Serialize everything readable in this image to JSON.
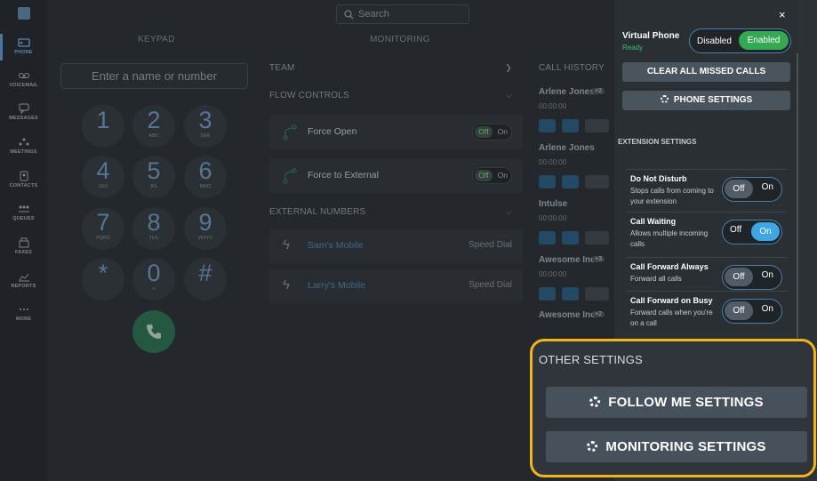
{
  "sidebar": {
    "items": [
      {
        "label": "PHONE",
        "icon": "phone-icon"
      },
      {
        "label": "VOICEMAIL",
        "icon": "voicemail-icon"
      },
      {
        "label": "MESSAGES",
        "icon": "messages-icon"
      },
      {
        "label": "MEETINGS",
        "icon": "meetings-icon"
      },
      {
        "label": "CONTACTS",
        "icon": "contacts-icon"
      },
      {
        "label": "QUEUES",
        "icon": "queues-icon"
      },
      {
        "label": "FAXES",
        "icon": "faxes-icon"
      },
      {
        "label": "REPORTS",
        "icon": "reports-icon"
      },
      {
        "label": "MORE",
        "icon": "more-icon"
      }
    ]
  },
  "search": {
    "placeholder": "Search"
  },
  "tabs": {
    "keypad": "KEYPAD",
    "monitoring": "MONITORING"
  },
  "keypad": {
    "input_placeholder": "Enter a name or number",
    "keys": [
      {
        "digit": "1",
        "letters": ""
      },
      {
        "digit": "2",
        "letters": "ABC"
      },
      {
        "digit": "3",
        "letters": "DEF"
      },
      {
        "digit": "4",
        "letters": "GHI"
      },
      {
        "digit": "5",
        "letters": "JKL"
      },
      {
        "digit": "6",
        "letters": "MNO"
      },
      {
        "digit": "7",
        "letters": "PQRS"
      },
      {
        "digit": "8",
        "letters": "TUV"
      },
      {
        "digit": "9",
        "letters": "WXYZ"
      },
      {
        "digit": "*",
        "letters": ""
      },
      {
        "digit": "0",
        "letters": "+"
      },
      {
        "digit": "#",
        "letters": ""
      }
    ]
  },
  "monitoring": {
    "team": "TEAM",
    "flow_controls": "FLOW CONTROLS",
    "force_open": {
      "label": "Force Open",
      "off": "Off",
      "on": "On"
    },
    "force_external": {
      "label": "Force to External",
      "off": "Off",
      "on": "On"
    },
    "external_numbers": "EXTERNAL NUMBERS",
    "numbers": [
      {
        "name": "Sam's Mobile",
        "type": "Speed Dial"
      },
      {
        "name": "Larry's Mobile",
        "type": "Speed Dial"
      }
    ]
  },
  "call_history": {
    "title": "CALL HISTORY",
    "entries": [
      {
        "name": "Arlene Jones",
        "badge": "+2",
        "time": "00:00:00"
      },
      {
        "name": "Arlene Jones",
        "badge": "",
        "time": "00:00:00"
      },
      {
        "name": "Intulse",
        "badge": "",
        "time": "00:00:00"
      },
      {
        "name": "Awesome Inc",
        "badge": "+3",
        "time": "00:00:00"
      },
      {
        "name": "Awesome Inc",
        "badge": "+2",
        "time": ""
      }
    ]
  },
  "panel": {
    "close": "×",
    "virtual_phone": {
      "title": "Virtual Phone",
      "status": "Ready",
      "disabled": "Disabled",
      "enabled": "Enabled"
    },
    "clear_missed": "CLEAR ALL MISSED CALLS",
    "phone_settings": "PHONE SETTINGS",
    "extension_settings": "EXTENSION SETTINGS",
    "settings": [
      {
        "title": "Do Not Disturb",
        "desc": "Stops calls from coming to your extension",
        "off": "Off",
        "on": "On",
        "state": "off"
      },
      {
        "title": "Call Waiting",
        "desc": "Allows multiple incoming calls",
        "off": "Off",
        "on": "On",
        "state": "on"
      },
      {
        "title": "Call Forward Always",
        "desc": "Forward all calls",
        "off": "Off",
        "on": "On",
        "state": "off"
      },
      {
        "title": "Call Forward on Busy",
        "desc": "Forward calls when you're on a call",
        "off": "Off",
        "on": "On",
        "state": "off"
      }
    ],
    "other_settings": "OTHER SETTINGS",
    "follow_me": "FOLLOW ME SETTINGS",
    "monitoring_settings": "MONITORING SETTINGS"
  },
  "colors": {
    "accent": "#4d7ea8",
    "enabled_green": "#34a853",
    "toggle_on_blue": "#3fa5e3",
    "highlight": "#f1b51b"
  }
}
